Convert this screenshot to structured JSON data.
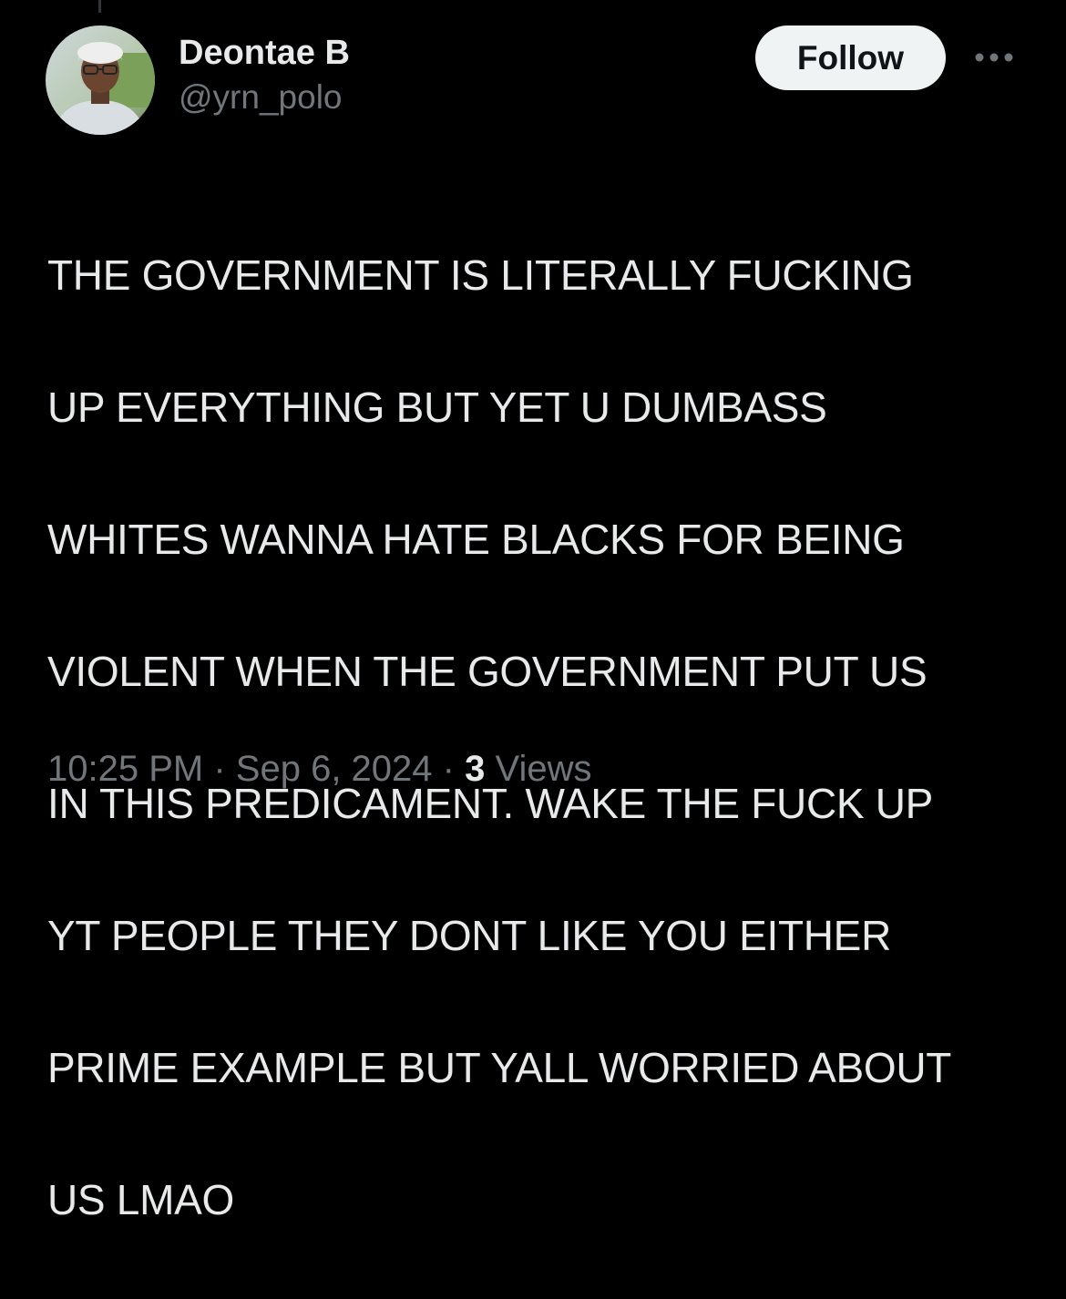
{
  "author": {
    "display_name": "Deontae B",
    "handle": "@yrn_polo"
  },
  "actions": {
    "follow_label": "Follow",
    "more_icon": "more-horizontal-icon"
  },
  "tweet": {
    "lines": [
      "THE GOVERNMENT IS LITERALLY FUCKING",
      "UP EVERYTHING BUT YET U DUMBASS",
      "WHITES WANNA HATE BLACKS FOR BEING",
      "VIOLENT WHEN THE GOVERNMENT PUT US",
      "IN THIS PREDICAMENT. WAKE THE FUCK UP",
      "YT PEOPLE THEY DONT LIKE YOU EITHER",
      "PRIME EXAMPLE BUT YALL WORRIED ABOUT",
      "US LMAO"
    ]
  },
  "meta": {
    "time": "10:25 PM",
    "separator": "·",
    "date": "Sep 6, 2024",
    "views_count": "3",
    "views_label": "Views"
  },
  "colors": {
    "background": "#000000",
    "primary_text": "#e7e9ea",
    "secondary_text": "#71767b",
    "follow_button_bg": "#eff3f4",
    "follow_button_text": "#0f1419"
  }
}
